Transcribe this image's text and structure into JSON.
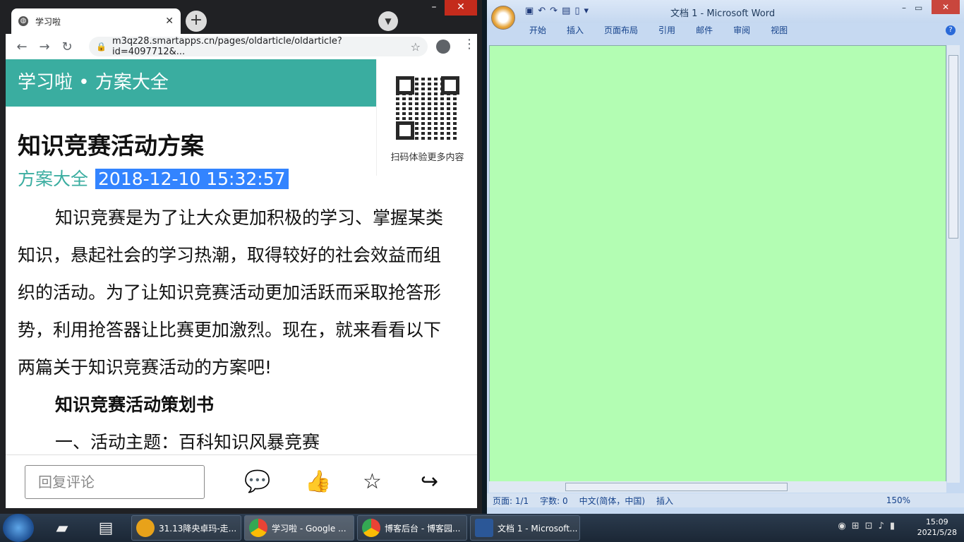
{
  "browser": {
    "tab_title": "学习啦",
    "new_tab": "+",
    "url": "m3qz28.smartapps.cn/pages/oldarticle/oldarticle?id=4097712&..."
  },
  "page": {
    "banner": "学习啦 • 方案大全",
    "qr_label": "扫码体验更多内容",
    "title": "知识竞赛活动方案",
    "category": "方案大全",
    "date": "2018-12-10 15:32:57",
    "paragraphs": [
      "知识竞赛是为了让大众更加积极的学习、掌握某类知识，悬起社会的学习热潮，取得较好的社会效益而组织的活动。为了让知识竞赛活动更加活跃而采取抢答形势，利用抢答器让比赛更加激烈。现在，就来看看以下两篇关于知识竞赛活动的方案吧!"
    ],
    "subtitle": "知识竞赛活动策划书",
    "item1": "一、活动主题：百科知识风暴竞赛",
    "reply_placeholder": "回复评论"
  },
  "word": {
    "title": "文档 1 - Microsoft Word",
    "tabs": [
      "开始",
      "插入",
      "页面布局",
      "引用",
      "邮件",
      "审阅",
      "视图"
    ],
    "status_page": "页面: 1/1",
    "status_words": "字数: 0",
    "status_lang": "中文(简体，中国)",
    "status_mode": "插入",
    "zoom": "150%"
  },
  "taskbar": {
    "tasks": [
      "31.13降央卓玛-走...",
      "学习啦 - Google ...",
      "博客后台 - 博客园...",
      "文档 1 - Microsoft..."
    ],
    "time": "15:09",
    "date": "2021/5/28"
  }
}
